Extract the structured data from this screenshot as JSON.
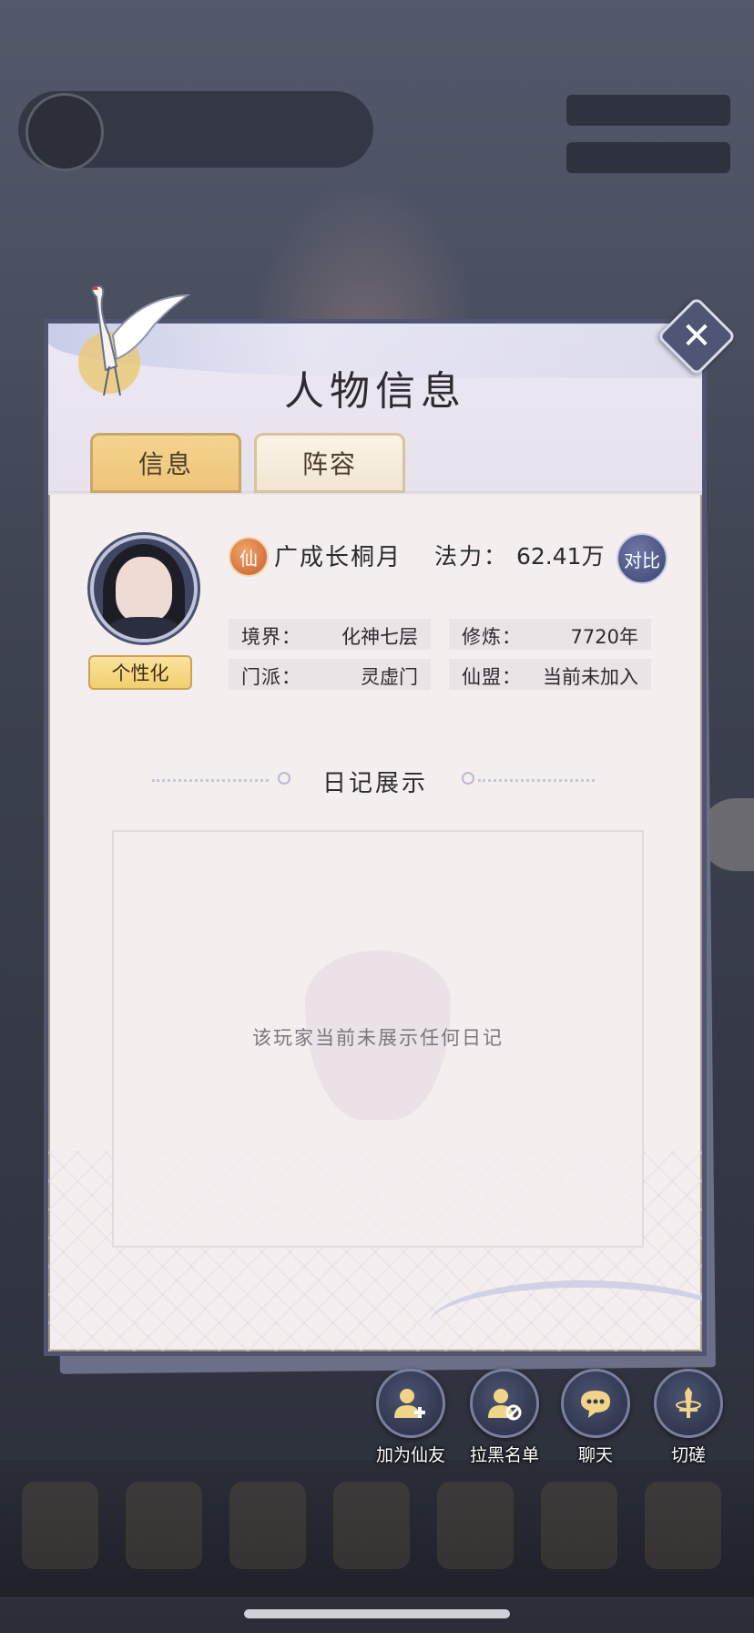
{
  "panel": {
    "title": "人物信息",
    "close_label": "✕"
  },
  "tabs": [
    {
      "label": "信息",
      "active": true
    },
    {
      "label": "阵容",
      "active": false
    }
  ],
  "player": {
    "rank_badge": "仙",
    "name": "广成长桐月",
    "power_label": "法力：",
    "power_value": "62.41万",
    "compare_label": "对比",
    "personalize_label": "个性化",
    "stats": {
      "realm": {
        "label": "境界：",
        "value": "化神七层"
      },
      "cultivation": {
        "label": "修炼：",
        "value": "7720年"
      },
      "sect": {
        "label": "门派：",
        "value": "灵虚门"
      },
      "alliance": {
        "label": "仙盟：",
        "value": "当前未加入"
      }
    }
  },
  "diary": {
    "title": "日记展示",
    "empty_text": "该玩家当前未展示任何日记"
  },
  "actions": [
    {
      "label": "加为仙友",
      "icon": "add-friend-icon"
    },
    {
      "label": "拉黑名单",
      "icon": "block-user-icon"
    },
    {
      "label": "聊天",
      "icon": "chat-bubble-icon"
    },
    {
      "label": "切磋",
      "icon": "sword-icon"
    }
  ],
  "colors": {
    "panel_bg": "#f4efee",
    "panel_border": "#4f5470",
    "tab_active": "#f1cd84",
    "tab_inactive": "#f5ecdc",
    "action_circle": "#343a55"
  }
}
